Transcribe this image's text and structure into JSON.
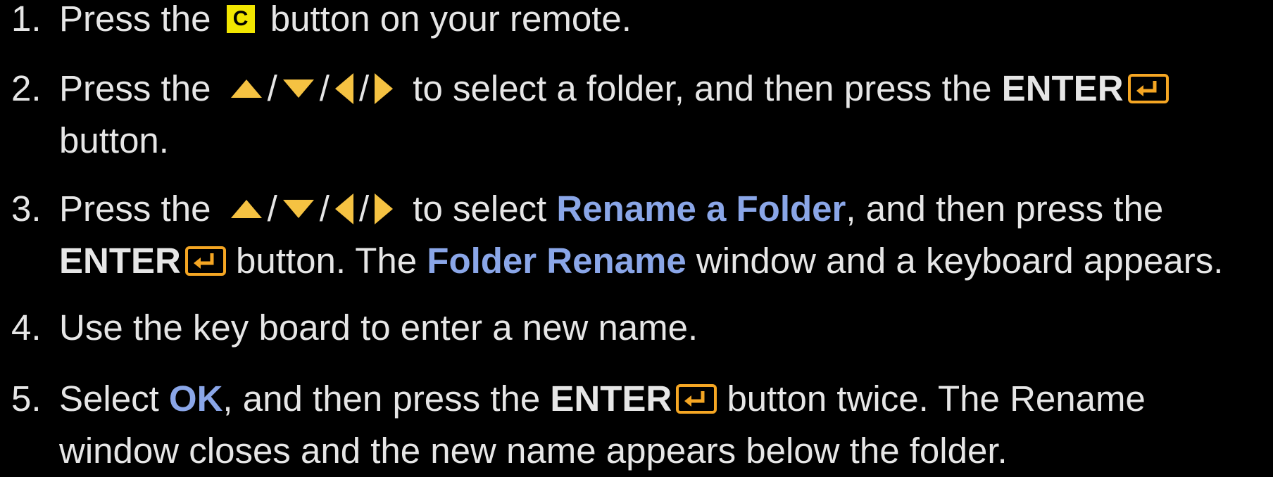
{
  "colors": {
    "background": "#000000",
    "text": "#e6e6e6",
    "highlight_blue": "#8aa6e8",
    "arrow_yellow": "#f5c242",
    "c_button_bg": "#f2e600",
    "enter_icon": "#f5a623"
  },
  "steps": [
    {
      "number": "1.",
      "pre": "Press the",
      "button_label": "C",
      "post": "button on your remote."
    },
    {
      "number": "2.",
      "pre": "Press the",
      "slash": "/",
      "mid": "to select a folder, and then press the",
      "enter": "ENTER",
      "line2": "button."
    },
    {
      "number": "3.",
      "pre": "Press the",
      "slash": "/",
      "mid": "to select",
      "highlight1": "Rename a Folder",
      "mid2": ", and then press the",
      "enter": "ENTER",
      "mid3": "button. The",
      "highlight2": "Folder Rename",
      "post": "window and a keyboard appears."
    },
    {
      "number": "4.",
      "text": "Use the key board to enter a new name."
    },
    {
      "number": "5.",
      "pre": "Select",
      "highlight": "OK",
      "mid": ", and then press the",
      "enter": "ENTER",
      "post": "button twice. The Rename",
      "line2": "window closes and the new name appears below the folder."
    }
  ],
  "icons": {
    "up": "up-arrow-icon",
    "down": "down-arrow-icon",
    "left": "left-arrow-icon",
    "right": "right-arrow-icon",
    "enter": "enter-key-icon",
    "c_button": "c-button-icon"
  }
}
